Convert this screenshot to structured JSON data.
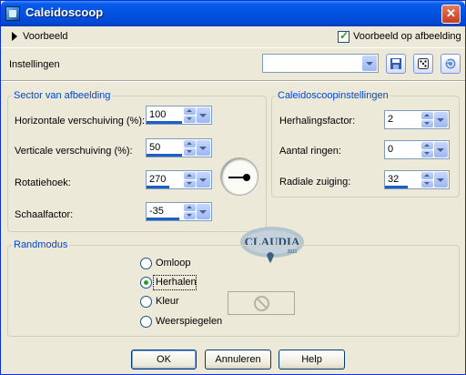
{
  "window": {
    "title": "Caleidoscoop",
    "close_glyph": "✕"
  },
  "top": {
    "voorbeeld": "Voorbeeld",
    "preview_label": "Voorbeeld op afbeelding",
    "preview_checked": true
  },
  "instellingen": {
    "label": "Instellingen",
    "value": "",
    "icons": [
      "save-preset-icon",
      "random-dice-icon",
      "reset-icon"
    ]
  },
  "sector": {
    "title": "Sector van afbeelding",
    "fields": [
      {
        "label": "Horizontale verschuiving (%):",
        "value": "100",
        "fill": 0.55
      },
      {
        "label": "Verticale verschuiving (%):",
        "value": "50",
        "fill": 0.55
      },
      {
        "label": "Rotatiehoek:",
        "value": "270",
        "fill": 0.35
      },
      {
        "label": "Schaalfactor:",
        "value": "-35",
        "fill": 0.5
      }
    ]
  },
  "instellingen_group": {
    "title": "Caleidoscoopinstellingen",
    "fields": [
      {
        "label": "Herhalingsfactor:",
        "value": "2",
        "fill": 0.0
      },
      {
        "label": "Aantal ringen:",
        "value": "0",
        "fill": 0.0
      },
      {
        "label": "Radiale zuiging:",
        "value": "32",
        "fill": 0.35
      }
    ]
  },
  "watermark": {
    "text": "CLAUDIA",
    "subtext": "2011"
  },
  "randmodus": {
    "title": "Randmodus",
    "options": [
      "Omloop",
      "Herhalen",
      "Kleur",
      "Weerspiegelen"
    ],
    "selected": "Herhalen"
  },
  "buttons": {
    "ok": "OK",
    "cancel": "Annuleren",
    "help": "Help"
  },
  "colors": {
    "accent": "#0046d5",
    "title_bar": "#0052e0",
    "check_green": "#21a121"
  }
}
